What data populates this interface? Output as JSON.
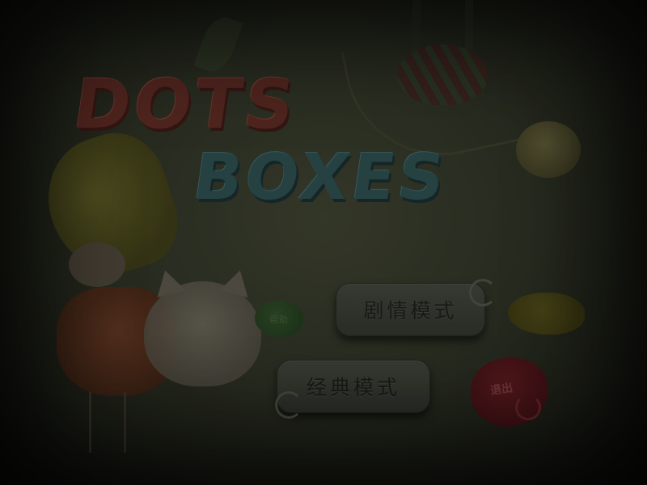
{
  "game": {
    "logo_line1": "DOTS",
    "logo_line2": "BOXES"
  },
  "menu": {
    "story_mode_label": "剧情模式",
    "classic_mode_label": "经典模式"
  },
  "side_buttons": {
    "help_label": "帮助",
    "exit_label": "退出"
  },
  "colors": {
    "overlay": "#000000",
    "button_face": "#3a3d34",
    "exit_bubble": "#5a1a1f",
    "sound_bubble": "#4d4a19",
    "help_bubble": "#2f4a28"
  },
  "state": {
    "dimmed_overlay": true
  }
}
